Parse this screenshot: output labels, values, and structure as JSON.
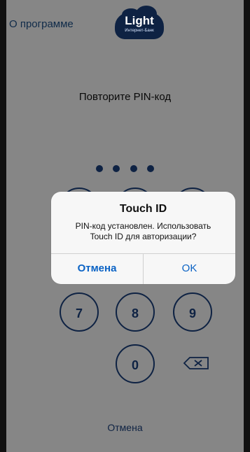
{
  "header": {
    "about_label": "О программе",
    "logo_text": "Light",
    "logo_subtext": "Интернет-Банк"
  },
  "pin": {
    "prompt": "Повторите PIN-код",
    "entered_count": 4
  },
  "keypad": {
    "keys": [
      "7",
      "8",
      "9",
      "0"
    ]
  },
  "footer": {
    "cancel_label": "Отмена"
  },
  "alert": {
    "title": "Touch ID",
    "message": "PIN-код установлен. Использовать Touch ID для авторизации?",
    "cancel_label": "Отмена",
    "ok_label": "OK"
  },
  "colors": {
    "brand": "#1b3f7a",
    "link": "#0b63c5"
  }
}
